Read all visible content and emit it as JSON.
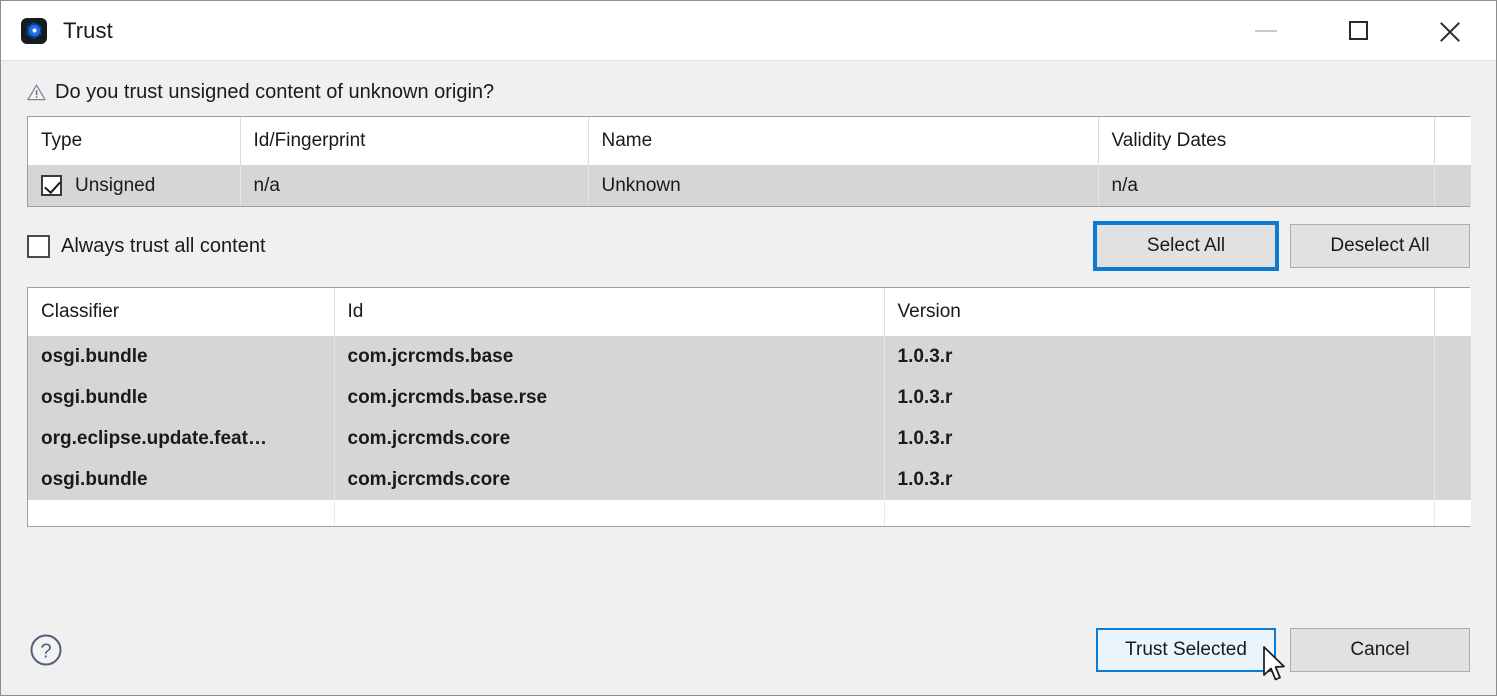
{
  "window": {
    "title": "Trust",
    "icon": "eclipse-app-icon",
    "controls": {
      "minimize": "minimize-icon",
      "maximize": "maximize-icon",
      "close": "close-icon"
    }
  },
  "prompt": {
    "icon": "warning-triangle-icon",
    "text": "Do you trust unsigned content of unknown origin?"
  },
  "certificate_table": {
    "columns": [
      "Type",
      "Id/Fingerprint",
      "Name",
      "Validity Dates",
      ""
    ],
    "rows": [
      {
        "checked": true,
        "type": "Unsigned",
        "fingerprint": "n/a",
        "name": "Unknown",
        "validity": "n/a",
        "extra": ""
      }
    ]
  },
  "always_trust": {
    "label": "Always trust all content",
    "checked": false
  },
  "selection_buttons": {
    "select_all": "Select All",
    "deselect_all": "Deselect All"
  },
  "iu_table": {
    "columns": [
      "Classifier",
      "Id",
      "Version",
      ""
    ],
    "rows": [
      {
        "classifier": "osgi.bundle",
        "id": "com.jcrcmds.base",
        "version": "1.0.3.r",
        "extra": ""
      },
      {
        "classifier": "osgi.bundle",
        "id": "com.jcrcmds.base.rse",
        "version": "1.0.3.r",
        "extra": ""
      },
      {
        "classifier": "org.eclipse.update.feat…",
        "id": "com.jcrcmds.core",
        "version": "1.0.3.r",
        "extra": ""
      },
      {
        "classifier": "osgi.bundle",
        "id": "com.jcrcmds.core",
        "version": "1.0.3.r",
        "extra": ""
      }
    ]
  },
  "footer": {
    "help_icon": "help-circle-icon",
    "trust_selected": "Trust Selected",
    "cancel": "Cancel"
  },
  "colors": {
    "accent": "#0b7bd4",
    "dialog_bg": "#f0f0f0",
    "titlebar_bg": "#ffffff",
    "row_selected": "#d6d6d6",
    "button_bg": "#e1e1e1",
    "hover_bg": "#e9f4fd"
  }
}
